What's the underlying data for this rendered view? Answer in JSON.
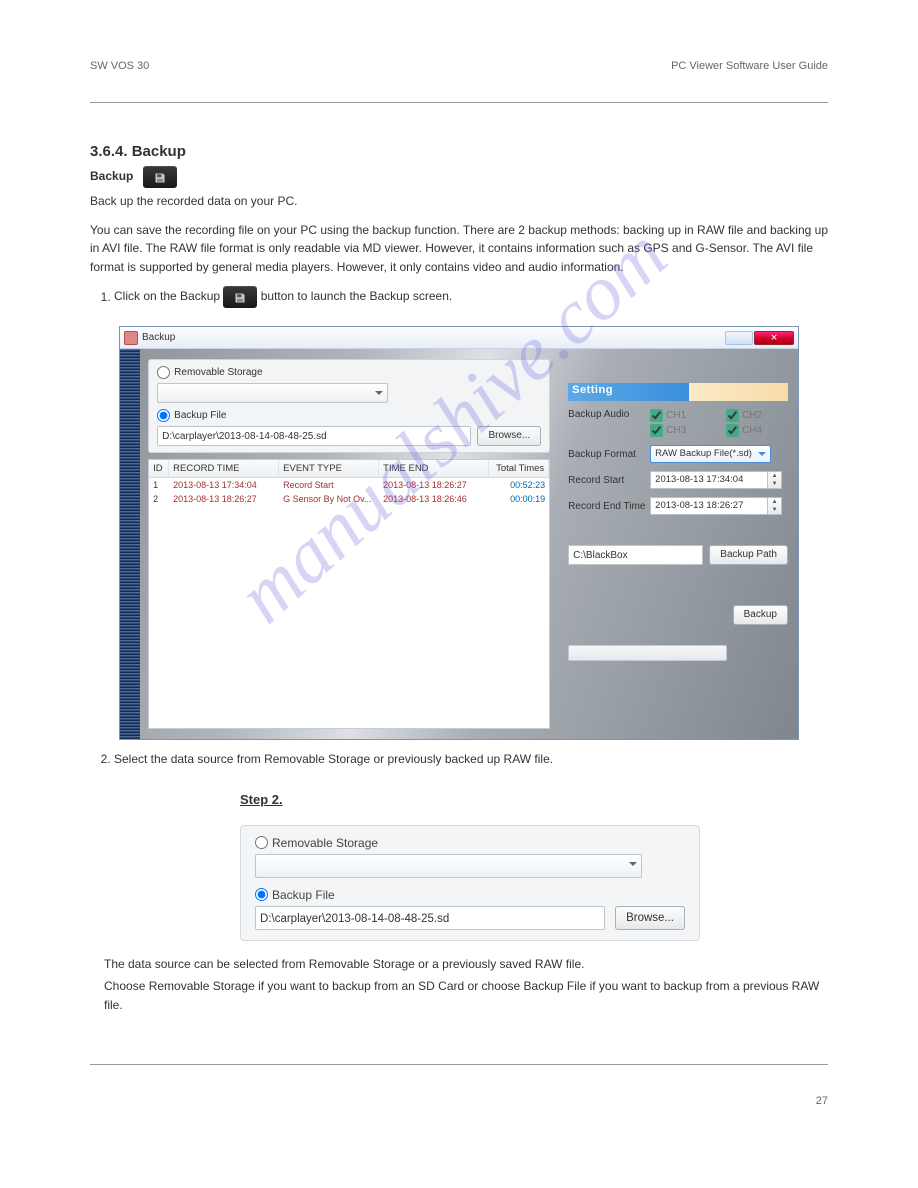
{
  "header": {
    "left": "SW VOS 30",
    "right": "PC Viewer Software User Guide"
  },
  "sections": {
    "backup_title": "3.6.4. Backup",
    "backup_btn_label": "Backup",
    "backup_intro": "Back up the recorded data on your PC.",
    "backup_explain": "You can save the recording file on your PC using the backup function. There are 2 backup methods: backing up in RAW file and backing up in AVI file. The RAW file format is only readable via MD viewer. However, it contains information such as GPS and G-Sensor. The AVI file format is supported by general media players. However, it only contains video and audio information.",
    "steps": [
      {
        "pre": "Click on the Backup ",
        "post": " button to launch the Backup screen."
      },
      {
        "pre": "Select the data source from Removable Storage or previously backed up RAW file."
      }
    ],
    "step2_p1": "The data source can be selected from Removable Storage or a previously saved RAW file.",
    "step2_p2": "Choose Removable Storage if you want to backup from an SD Card or choose Backup File if you want to backup from a previous RAW file."
  },
  "backup_window": {
    "title": "Backup",
    "source": {
      "removable_label": "Removable Storage",
      "backup_file_label": "Backup File",
      "file_path": "D:\\carplayer\\2013-08-14-08-48-25.sd",
      "browse_label": "Browse..."
    },
    "table": {
      "headers": {
        "id": "ID",
        "record_time": "RECORD TIME",
        "event_type": "EVENT TYPE",
        "time_end": "TIME END",
        "total_times": "Total Times"
      },
      "rows": [
        {
          "id": "1",
          "record_time": "2013-08-13 17:34:04",
          "event_type": "Record Start",
          "time_end": "2013-08-13 18:26:27",
          "total_times": "00:52:23"
        },
        {
          "id": "2",
          "record_time": "2013-08-13 18:26:27",
          "event_type": "G Sensor By Not Ov...",
          "time_end": "2013-08-13 18:26:46",
          "total_times": "00:00:19"
        }
      ]
    },
    "settings": {
      "header": "Setting",
      "backup_audio_label": "Backup Audio",
      "ch1": "CH1",
      "ch2": "CH2",
      "ch3": "CH3",
      "ch4": "CH4",
      "backup_format_label": "Backup Format",
      "backup_format_value": "RAW Backup File(*.sd)",
      "record_start_label": "Record Start",
      "record_start_value": "2013-08-13 17:34:04",
      "record_end_label": "Record End Time",
      "record_end_value": "2013-08-13 18:26:27",
      "backup_path_value": "C:\\BlackBox",
      "backup_path_label": "Backup Path",
      "backup_button_label": "Backup"
    }
  },
  "panel2_heading": "Step 2.",
  "footer": {
    "page": "27"
  }
}
